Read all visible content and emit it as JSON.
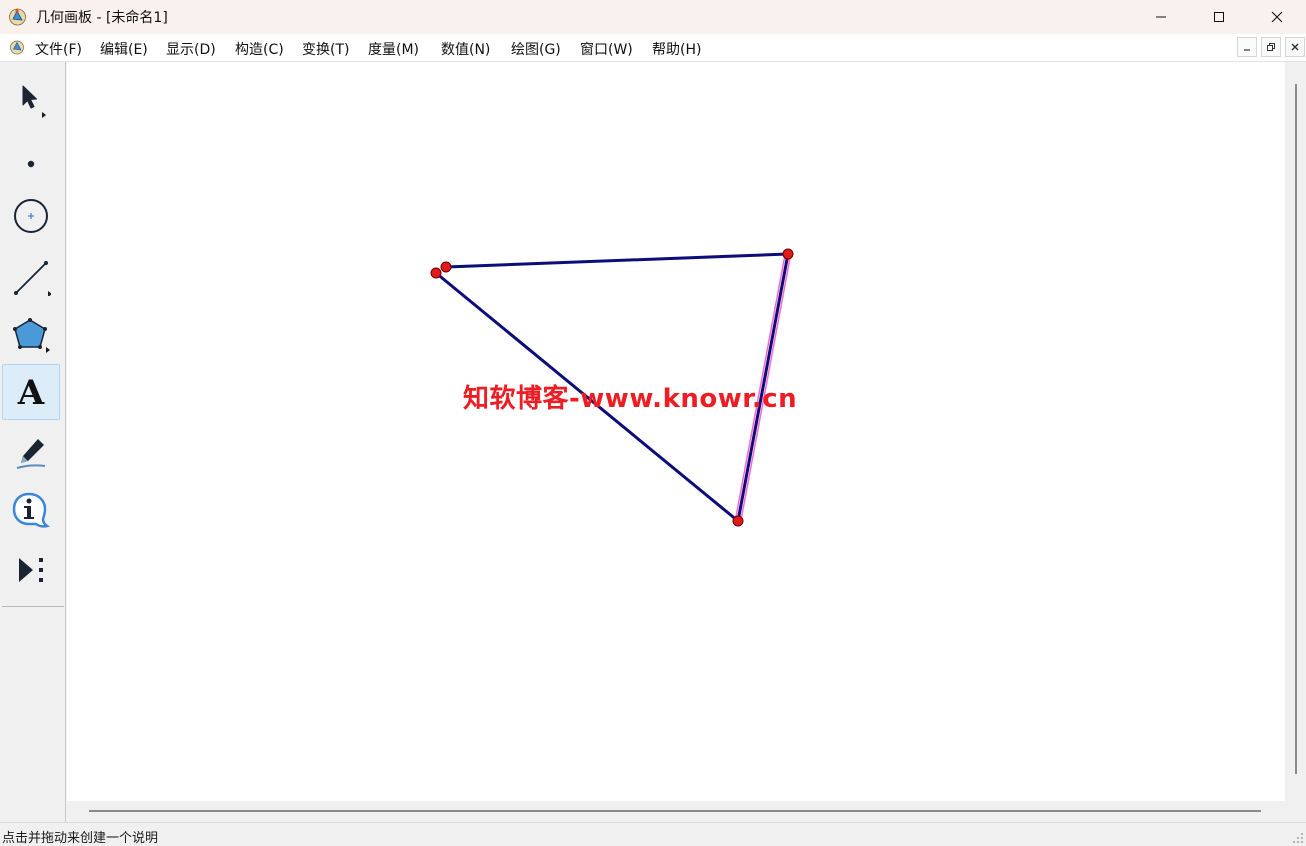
{
  "window": {
    "title": "几何画板 - [未命名1]",
    "icon": "sketchpad-app-icon"
  },
  "menu": {
    "items": [
      "文件(F)",
      "编辑(E)",
      "显示(D)",
      "构造(C)",
      "变换(T)",
      "度量(M)",
      "数值(N)",
      "绘图(G)",
      "窗口(W)",
      "帮助(H)"
    ]
  },
  "toolbox": {
    "tools": [
      {
        "name": "arrow-select-tool",
        "icon": "arrow-icon",
        "has_submenu": true
      },
      {
        "name": "point-tool",
        "icon": "point-icon",
        "has_submenu": false
      },
      {
        "name": "compass-tool",
        "icon": "circle-icon",
        "has_submenu": false
      },
      {
        "name": "straightedge-tool",
        "icon": "segment-icon",
        "has_submenu": true
      },
      {
        "name": "polygon-tool",
        "icon": "polygon-icon",
        "has_submenu": true
      },
      {
        "name": "text-tool",
        "icon": "text-A-icon",
        "has_submenu": false,
        "active": true
      },
      {
        "name": "marker-tool",
        "icon": "pen-icon",
        "has_submenu": false
      },
      {
        "name": "information-tool",
        "icon": "info-icon",
        "has_submenu": false
      },
      {
        "name": "custom-tool",
        "icon": "play-more-icon",
        "has_submenu": false
      }
    ],
    "active_color": "#dcecf8"
  },
  "sketch": {
    "segment_color": "#0d0d7a",
    "point_color": "#e11a1a",
    "selection_color": "#ff66cc",
    "watermark": "知软博客-www.knowr.cn",
    "watermark_color": "#ee1d23"
  },
  "status": {
    "text": "点击并拖动来创建一个说明"
  }
}
